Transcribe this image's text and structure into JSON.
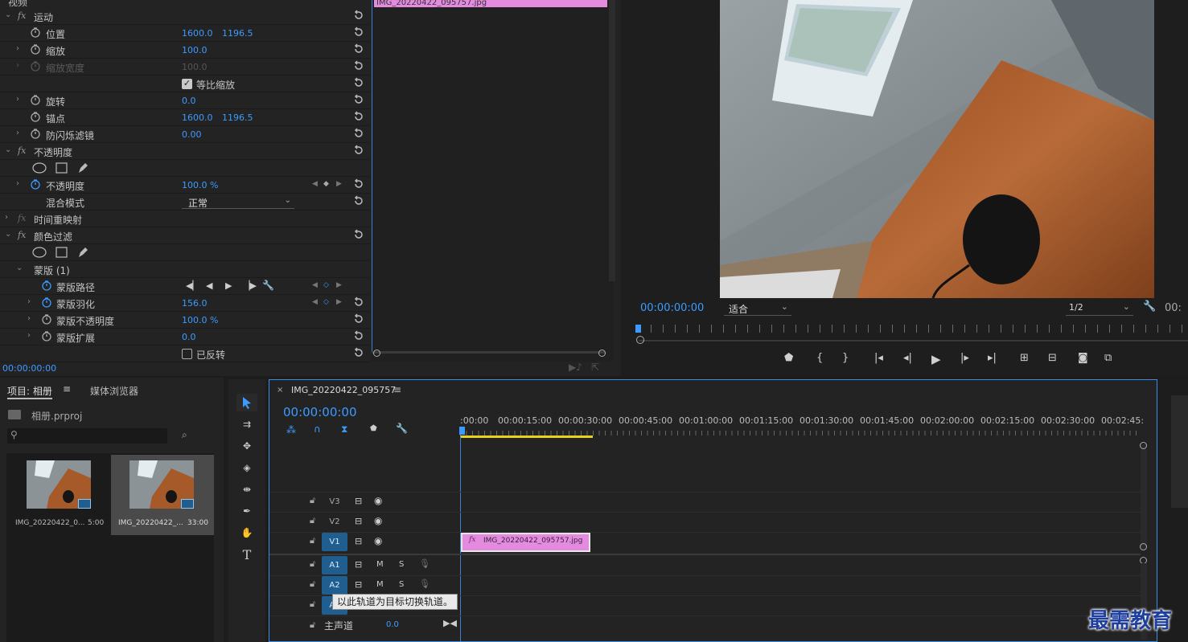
{
  "effect_controls": {
    "header": "视频",
    "timecode": "00:00:00:00",
    "clip_label": "IMG_20220422_095757.jpg",
    "motion": {
      "title": "运动",
      "position": {
        "label": "位置",
        "x": "1600.0",
        "y": "1196.5"
      },
      "scale": {
        "label": "缩放",
        "value": "100.0"
      },
      "scale_width": {
        "label": "缩放宽度",
        "value": "100.0"
      },
      "uniform_scale": {
        "label": "等比缩放",
        "checked": true
      },
      "rotation": {
        "label": "旋转",
        "value": "0.0"
      },
      "anchor": {
        "label": "锚点",
        "x": "1600.0",
        "y": "1196.5"
      },
      "anti_flicker": {
        "label": "防闪烁滤镜",
        "value": "0.00"
      }
    },
    "opacity": {
      "title": "不透明度",
      "value_label": "不透明度",
      "value": "100.0 %",
      "blend_label": "混合模式",
      "blend_value": "正常"
    },
    "time_remap": {
      "title": "时间重映射"
    },
    "color_filter": {
      "title": "颜色过滤",
      "mask": {
        "title": "蒙版 (1)",
        "path_label": "蒙版路径",
        "feather_label": "蒙版羽化",
        "feather_value": "156.0",
        "opacity_label": "蒙版不透明度",
        "opacity_value": "100.0 %",
        "expansion_label": "蒙版扩展",
        "expansion_value": "0.0",
        "inverted_label": "已反转"
      }
    }
  },
  "program_monitor": {
    "timecode": "00:00:00:00",
    "fit_value": "适合",
    "resolution": "1/2",
    "right_timecode": "00:"
  },
  "project": {
    "tab_project": "项目: 相册",
    "tab_media": "媒体浏览器",
    "file": "相册.prproj",
    "search_placeholder": "",
    "items": [
      {
        "name": "IMG_20220422_0...",
        "duration": "5:00"
      },
      {
        "name": "IMG_20220422_...",
        "duration": "33:00"
      }
    ]
  },
  "timeline": {
    "tab_title": "IMG_20220422_095757",
    "timecode": "00:00:00:00",
    "ruler": [
      ":00:00",
      "00:00:15:00",
      "00:00:30:00",
      "00:00:45:00",
      "00:01:00:00",
      "00:01:15:00",
      "00:01:30:00",
      "00:01:45:00",
      "00:02:00:00",
      "00:02:15:00",
      "00:02:30:00",
      "00:02:45:"
    ],
    "tracks": {
      "video": [
        "V3",
        "V2",
        "V1"
      ],
      "audio": [
        "A1",
        "A2",
        "A3"
      ],
      "mute": "M",
      "solo": "S",
      "master_label": "主声道",
      "master_value": "0.0"
    },
    "clip_name": "IMG_20220422_095757.jpg",
    "tooltip": "以此轨道为目标切换轨道。"
  },
  "watermark": "最需教育",
  "colors": {
    "accent": "#3d9bff",
    "clip_pink": "#e48be0",
    "track_target": "#1f5e8f",
    "playhead_yellow": "#e8d21a"
  }
}
